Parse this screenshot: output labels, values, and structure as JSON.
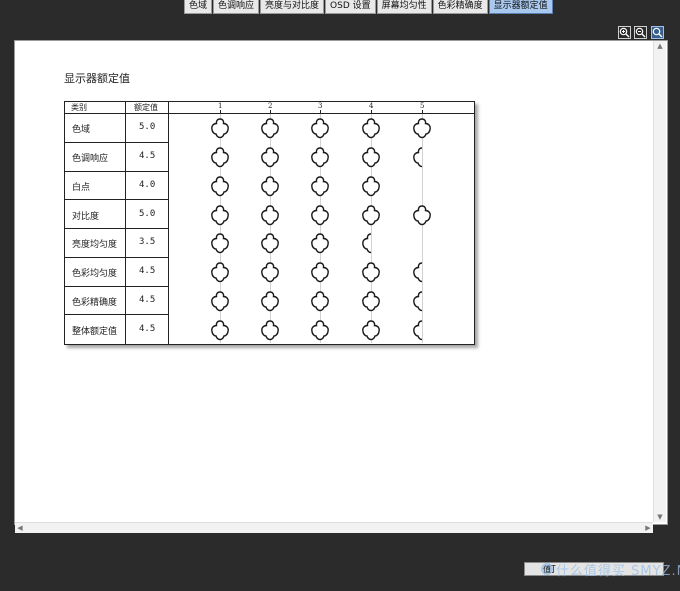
{
  "tabs": [
    {
      "label": "色域"
    },
    {
      "label": "色调响应"
    },
    {
      "label": "亮度与对比度"
    },
    {
      "label": "OSD 设置"
    },
    {
      "label": "屏幕均匀性"
    },
    {
      "label": "色彩精确度"
    },
    {
      "label": "显示器额定值"
    }
  ],
  "active_tab": "显示器额定值",
  "page": {
    "title": "显示器额定值"
  },
  "table": {
    "header_category": "类别",
    "header_rating": "额定值",
    "scale": [
      "1",
      "2",
      "3",
      "4",
      "5"
    ],
    "rows": [
      {
        "category": "色域",
        "rating": "5.0"
      },
      {
        "category": "色调响应",
        "rating": "4.5"
      },
      {
        "category": "白点",
        "rating": "4.0"
      },
      {
        "category": "对比度",
        "rating": "5.0"
      },
      {
        "category": "亮度均匀度",
        "rating": "3.5"
      },
      {
        "category": "色彩均匀度",
        "rating": "4.5"
      },
      {
        "category": "色彩精确度",
        "rating": "4.5"
      },
      {
        "category": "整体额定值",
        "rating": "4.5"
      }
    ]
  },
  "zoom": [
    {
      "icon": "zoom-in-icon"
    },
    {
      "icon": "zoom-out-icon"
    },
    {
      "icon": "zoom-fit-icon"
    }
  ],
  "footer": {
    "print_label": "打",
    "watermark": "什么值得买 SMYZ.NET"
  }
}
